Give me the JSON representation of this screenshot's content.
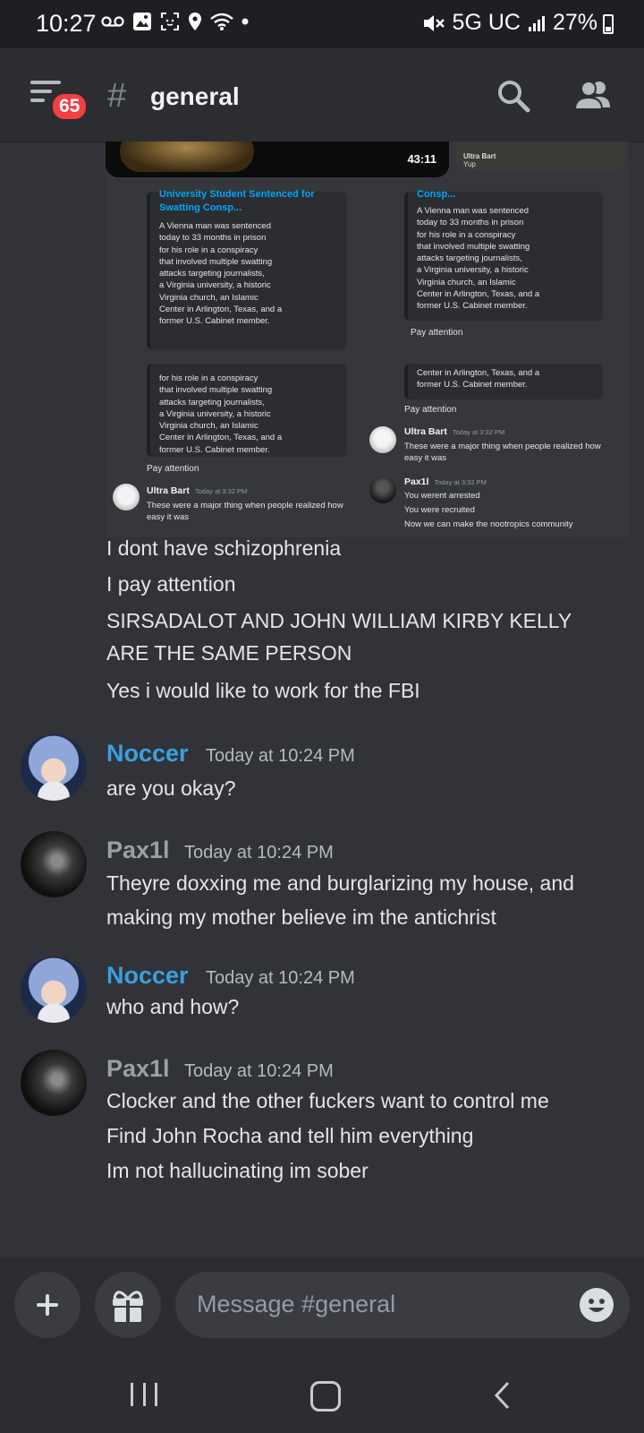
{
  "status_bar": {
    "time": "10:27",
    "network": "5G UC",
    "battery": "27%"
  },
  "header": {
    "badge": "65",
    "hash": "#",
    "channel": "general"
  },
  "embed": {
    "video_duration": "43:11",
    "reply_name": "Ultra Bart",
    "reply_text": "Yup",
    "card_title": "University Student Sentenced for Swatting Consp...",
    "card_title_short": "Consp...",
    "card_body_lines": [
      "A Vienna man was sentenced",
      "today to 33 months in prison",
      "for his role in a conspiracy",
      "that involved multiple swatting",
      "attacks targeting journalists,",
      "a Virginia university, a historic",
      "Virginia church, an Islamic",
      "Center in Arlington, Texas, and a",
      "former U.S. Cabinet member."
    ],
    "pay_attention": "Pay attention",
    "ultra_bart_name": "Ultra Bart",
    "ultra_bart_time": "Today at 3:32 PM",
    "ultra_bart_text": "These were a major thing when people realized how easy it was",
    "pax_name": "Pax1l",
    "pax_time": "Today at 3:32 PM",
    "pax_lines": [
      "You werent arrested",
      "You were recruited",
      "Now we can make the nootropics community"
    ]
  },
  "continued_lines": [
    "I dont have schizophrenia",
    "I pay attention",
    "SIRSADALOT AND JOHN WILLIAM KIRBY KELLY",
    "ARE THE SAME PERSON",
    "Yes i would like to work for the FBI"
  ],
  "messages": [
    {
      "author": "Noccer",
      "time": "Today at 10:24 PM",
      "lines": [
        "are you okay?"
      ]
    },
    {
      "author": "Pax1l",
      "time": "Today at 10:24 PM",
      "lines": [
        "Theyre doxxing me and burglarizing my house, and",
        "making my mother believe im the antichrist"
      ]
    },
    {
      "author": "Noccer",
      "time": "Today at 10:24 PM",
      "lines": [
        "who and how?"
      ]
    },
    {
      "author": "Pax1l",
      "time": "Today at 10:24 PM",
      "lines": [
        "Clocker and the other fuckers want to control me",
        "Find John Rocha and tell him everything",
        "Im not hallucinating im sober"
      ]
    }
  ],
  "composer": {
    "placeholder": "Message #general"
  },
  "colors": {
    "background": "#313338",
    "header": "#2b2d31",
    "noccer_name": "#3aa0e0",
    "pax_name": "#9aa0a6",
    "badge": "#f23f43",
    "link": "#00a8fc"
  }
}
